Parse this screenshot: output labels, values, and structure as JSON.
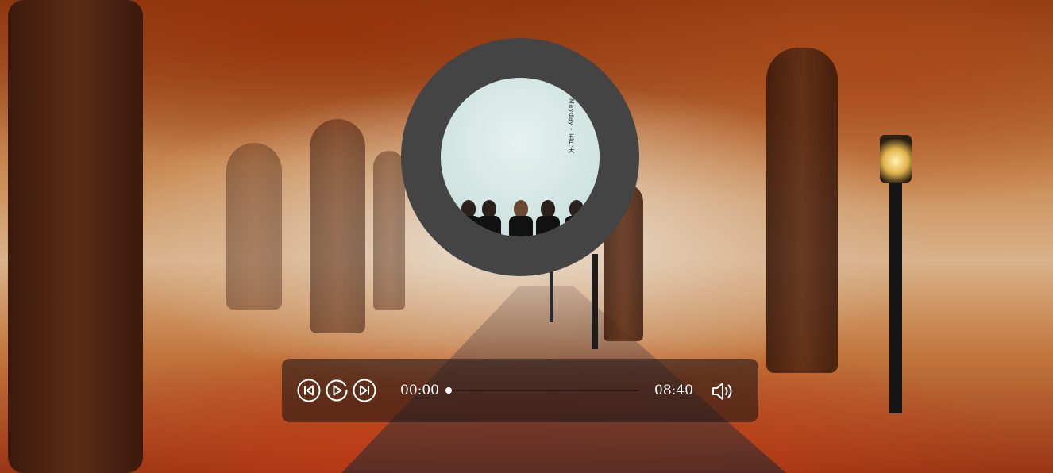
{
  "player": {
    "album": {
      "title": "Mayday - 五月天",
      "accent_color": "#444444"
    },
    "controls": {
      "prev_icon": "skip-previous-icon",
      "play_icon": "play-icon",
      "next_icon": "skip-next-icon",
      "volume_icon": "volume-icon"
    },
    "current_time": "00:00",
    "duration": "08:40",
    "progress": 0
  }
}
